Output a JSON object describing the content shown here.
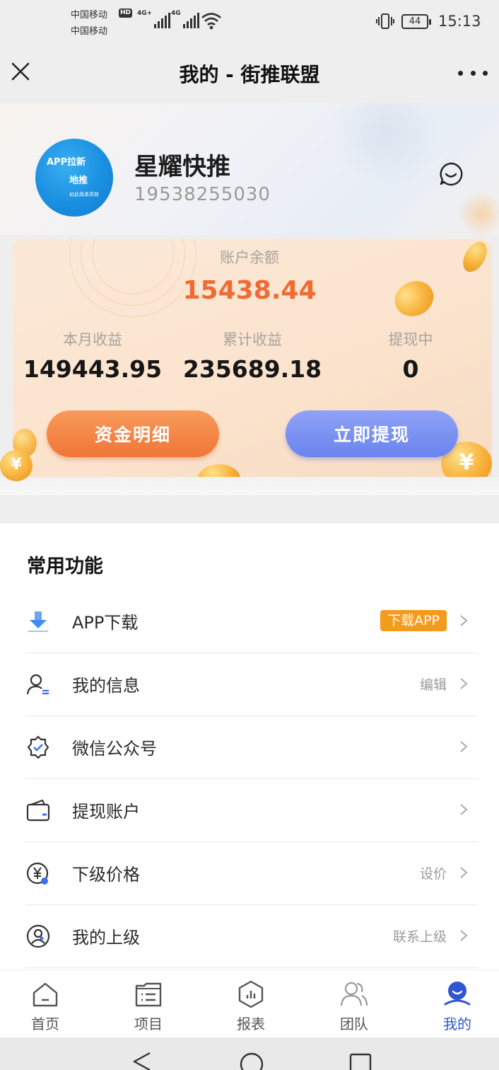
{
  "status_bar": {
    "carrier1": "中国移动",
    "carrier2": "中国移动",
    "hd_badge": "HD",
    "net1": "4G+",
    "net2": "4G",
    "battery": "44",
    "time": "15:13"
  },
  "title_bar": {
    "title": "我的 - 街推联盟",
    "close_icon": "close-icon",
    "more_icon": "more-dots-icon"
  },
  "profile": {
    "avatar_line1": "APP拉新",
    "avatar_line2": "地推",
    "avatar_line3": "如此简单高效",
    "name": "星耀快推",
    "phone": "19538255030",
    "chat_icon": "chat-bubble-icon"
  },
  "balance_card": {
    "balance_label": "账户余额",
    "balance_value": "15438.44",
    "stats": [
      {
        "label": "本月收益",
        "value": "149443.95"
      },
      {
        "label": "累计收益",
        "value": "235689.18"
      },
      {
        "label": "提现中",
        "value": "0"
      }
    ],
    "detail_button": "资金明细",
    "withdraw_button": "立即提现",
    "coin_glyph": "¥"
  },
  "functions": {
    "title": "常用功能",
    "items": [
      {
        "label": "APP下载",
        "badge": "下载APP",
        "extra": "",
        "icon": "download-icon"
      },
      {
        "label": "我的信息",
        "badge": "",
        "extra": "编辑",
        "icon": "user-info-icon"
      },
      {
        "label": "微信公众号",
        "badge": "",
        "extra": "",
        "icon": "verified-badge-icon"
      },
      {
        "label": "提现账户",
        "badge": "",
        "extra": "",
        "icon": "wallet-icon"
      },
      {
        "label": "下级价格",
        "badge": "",
        "extra": "设价",
        "icon": "price-yuan-icon"
      },
      {
        "label": "我的上级",
        "badge": "",
        "extra": "联系上级",
        "icon": "superior-user-icon"
      }
    ]
  },
  "bottom_nav": {
    "tabs": [
      {
        "label": "首页",
        "icon": "home-icon"
      },
      {
        "label": "项目",
        "icon": "project-list-icon"
      },
      {
        "label": "报表",
        "icon": "report-chart-icon"
      },
      {
        "label": "团队",
        "icon": "team-icon"
      },
      {
        "label": "我的",
        "icon": "profile-icon"
      }
    ],
    "active_index": 4
  },
  "colors": {
    "accent_orange": "#ef6b33",
    "accent_blue": "#2f55d4",
    "badge_orange": "#f59b1b"
  }
}
